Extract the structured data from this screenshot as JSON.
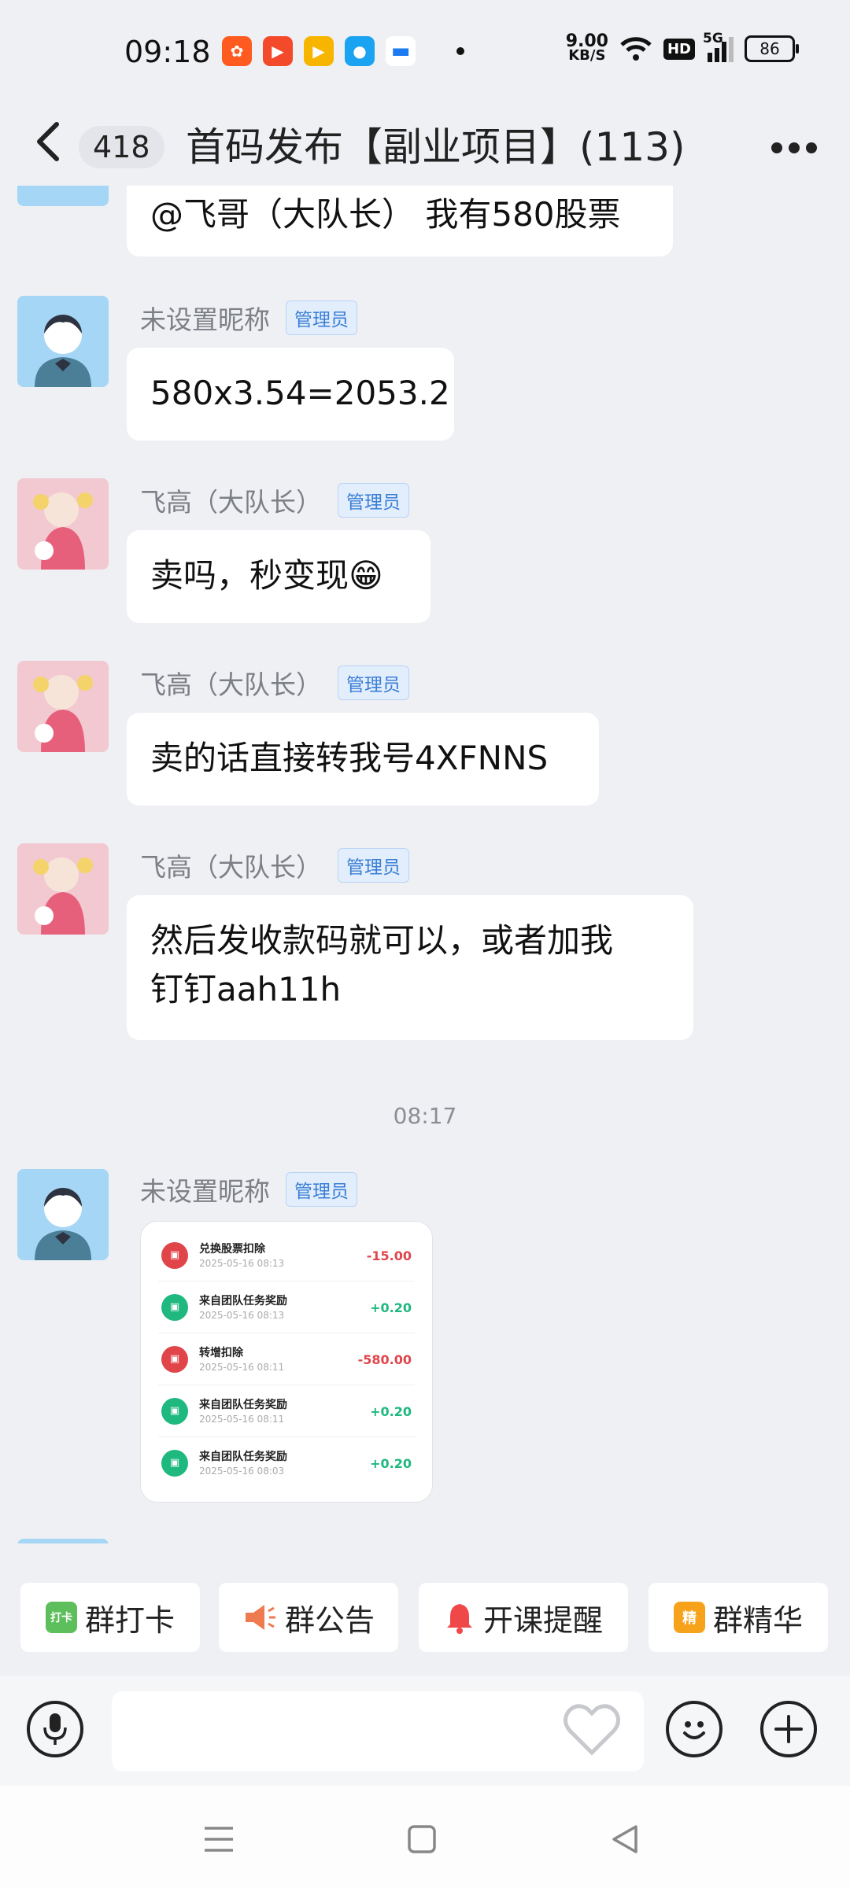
{
  "status_bar": {
    "time": "09:18",
    "net_speed_value": "9.00",
    "net_speed_unit": "KB/S",
    "hd": "HD",
    "network": "5G",
    "battery": "86"
  },
  "header": {
    "back_count": "418",
    "title": "首码发布【副业项目】(113)"
  },
  "messages": [
    {
      "text": "@飞哥（大队长） 我有580股票"
    },
    {
      "sender": "未设置昵称",
      "badge": "管理员",
      "text": "580x3.54=2053.2"
    },
    {
      "sender": "飞高（大队长）",
      "badge": "管理员",
      "text": "卖吗，秒变现😁"
    },
    {
      "sender": "飞高（大队长）",
      "badge": "管理员",
      "text": "卖的话直接转我号4XFNNS"
    },
    {
      "sender": "飞高（大队长）",
      "badge": "管理员",
      "text_line1": "然后发收款码就可以，或者加我",
      "text_line2": "钉钉aah11h"
    },
    {
      "sender": "未设置昵称",
      "badge": "管理员"
    }
  ],
  "timestamp": "08:17",
  "image_card": {
    "rows": [
      {
        "icon": "ticket-icon",
        "title": "兑换股票扣除",
        "date": "2025-05-16 08:13",
        "amount": "-15.00",
        "type": "debit"
      },
      {
        "icon": "ticket-icon",
        "title": "来自团队任务奖励",
        "date": "2025-05-16 08:13",
        "amount": "+0.20",
        "type": "credit"
      },
      {
        "icon": "ticket-icon",
        "title": "转增扣除",
        "date": "2025-05-16 08:11",
        "amount": "-580.00",
        "type": "debit"
      },
      {
        "icon": "ticket-icon",
        "title": "来自团队任务奖励",
        "date": "2025-05-16 08:11",
        "amount": "+0.20",
        "type": "credit"
      },
      {
        "icon": "ticket-icon",
        "title": "来自团队任务奖励",
        "date": "2025-05-16 08:03",
        "amount": "+0.20",
        "type": "credit"
      }
    ]
  },
  "quick_actions": [
    {
      "label": "群打卡",
      "icon_text": "打卡",
      "icon": "checkin-calendar-icon",
      "color": "#5cbf5c"
    },
    {
      "label": "群公告",
      "icon": "megaphone-icon",
      "color": "#f07a4f"
    },
    {
      "label": "开课提醒",
      "icon": "bell-icon",
      "color": "#f04848"
    },
    {
      "label": "群精华",
      "icon_text": "精",
      "icon": "essence-icon",
      "color": "#f7a21b"
    }
  ],
  "input": {
    "placeholder": ""
  },
  "colors": {
    "debit": "#e0454a",
    "credit": "#1fb87f",
    "admin_badge": "#3b7fd6"
  }
}
